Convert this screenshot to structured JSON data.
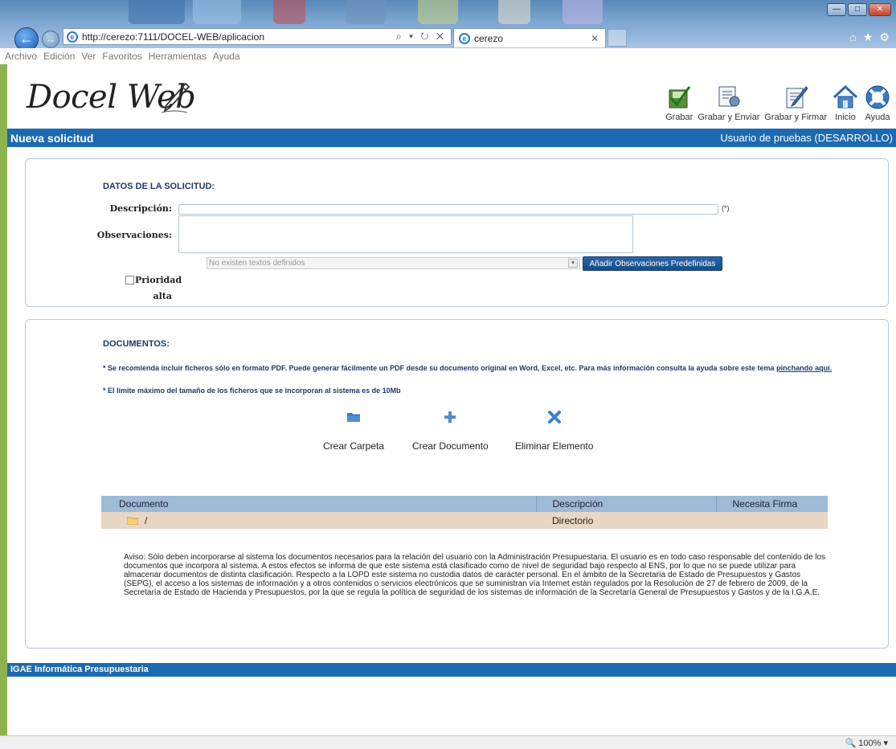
{
  "browser": {
    "url": "http://cerezo:7111/DOCEL-WEB/aplicacion",
    "address_tools": "⌕ ▾ ↻ ✕",
    "tab_title": "cerezo",
    "menu": [
      "Archivo",
      "Edición",
      "Ver",
      "Favoritos",
      "Herramientas",
      "Ayuda"
    ],
    "zoom": "100%"
  },
  "app": {
    "logo": "Docel Web",
    "toolbar": {
      "grabar": "Grabar",
      "grabar_enviar": "Grabar y Enviar",
      "grabar_firmar": "Grabar y Firmar",
      "inicio": "Inicio",
      "ayuda": "Ayuda"
    },
    "page_title": "Nueva solicitud",
    "user": "Usuario de pruebas (DESARROLLO)"
  },
  "solicitud": {
    "section_title": "DATOS DE LA SOLICITUD:",
    "descripcion_label": "Descripción:",
    "descripcion_value": "",
    "required_mark": "(*)",
    "observaciones_label": "Observaciones:",
    "observaciones_value": "",
    "predefined_select": "No existen textos definidos",
    "add_obs_button": "Añadir Observaciones Predefinidas",
    "prioridad_label_1": "Prioridad",
    "prioridad_label_2": "alta"
  },
  "documentos": {
    "section_title": "DOCUMENTOS:",
    "note1_text": "* Se recomienda incluir ficheros sólo en formato PDF. Puede generar fácilmente un PDF desde su documento original en Word, Excel, etc. Para más información consulta la ayuda sobre este tema ",
    "note1_link": "pinchando aquí.",
    "note2": "* El límite máximo del tamaño de los ficheros que se incorporan al sistema es de 10Mb",
    "actions": {
      "crear_carpeta": "Crear Carpeta",
      "crear_documento": "Crear Documento",
      "eliminar": "Eliminar Elemento"
    },
    "table": {
      "headers": [
        "Documento",
        "Descripción",
        "Necesita Firma"
      ],
      "rows": [
        {
          "documento": "/",
          "descripcion": "Directorio",
          "firma": ""
        }
      ]
    },
    "aviso": "Aviso: Sólo deben incorporarse al sistema los documentos necesarios para la relación del usuario con la Administración Presupuestaria. El usuario es en todo caso responsable del contenido de los documentos que incorpora al sistema. A estos efectos se informa de que este sistema está clasificado como de nivel de seguridad bajo respecto al ENS, por lo que no se puede utilizar para almacenar documentos de distinta clasificación. Respecto a la LOPD este sistema no custodia datos de carácter personal. En el ámbito de la Secretaría de Estado de Presupuestos y Gastos (SEPG), el acceso a los sistemas de información y a otros contenidos o servicios electrónicos que se suministran vía Internet están regulados por la Resolución de 27 de febrero de 2009, de la Secretaría de Estado de Hacienda y Presupuestos, por la que se regula la política de seguridad de los sistemas de información de la Secretaría General de Presupuestos y Gastos y de la I.G.A.E."
  },
  "footer": "IGAE Informática Presupuestaria",
  "colors": {
    "header_blue": "#1c6ab1",
    "table_header": "#9dbad6",
    "row_bg": "#e7d7c3",
    "left_accent": "#8db34e"
  }
}
